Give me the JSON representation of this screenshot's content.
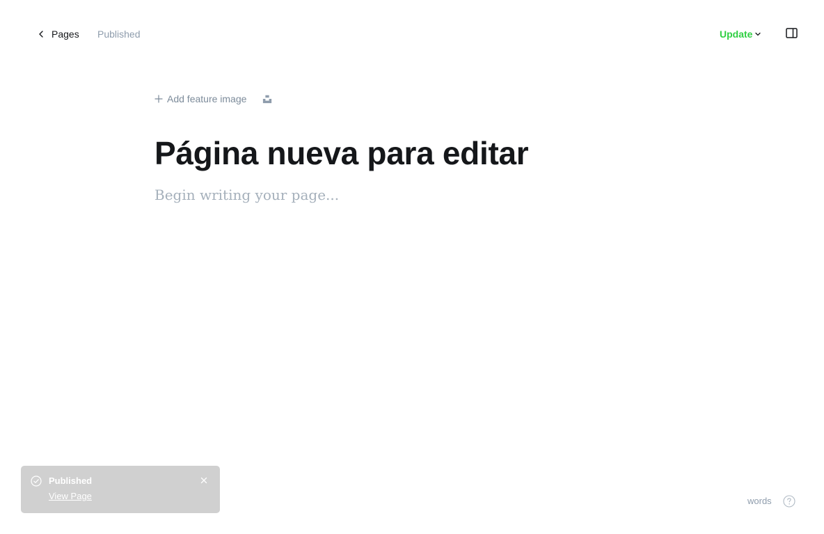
{
  "header": {
    "back_label": "Pages",
    "status": "Published",
    "update_label": "Update"
  },
  "editor": {
    "feature_image_label": "Add feature image",
    "title": "Página nueva para editar",
    "body_placeholder": "Begin writing your page..."
  },
  "toast": {
    "title": "Published",
    "link_label": "View Page"
  },
  "footer": {
    "word_count_label": "words"
  },
  "colors": {
    "accent_green": "#30cf43",
    "text_dark": "#15171a",
    "muted": "#8e9cac",
    "placeholder": "#a5b0bb",
    "toast_bg": "#d0d0d0"
  },
  "icons": {
    "back": "chevron-left-icon",
    "update_dropdown": "chevron-down-icon",
    "sidebar": "sidebar-toggle-icon",
    "add": "plus-icon",
    "unsplash": "unsplash-icon",
    "toast_status": "check-circle-icon",
    "toast_close": "close-icon",
    "help": "help-icon"
  }
}
